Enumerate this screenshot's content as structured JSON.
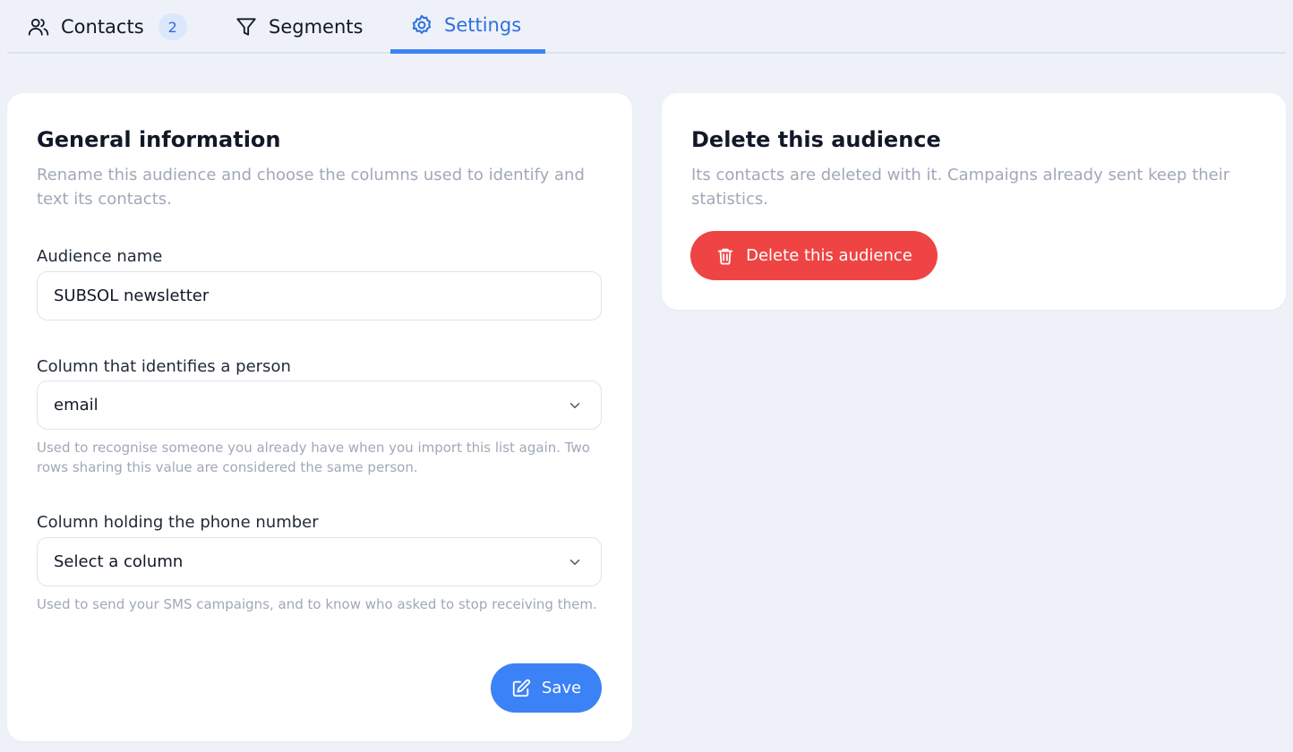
{
  "tabs": {
    "contacts": {
      "label": "Contacts",
      "badge": "2",
      "icon": "users-icon"
    },
    "segments": {
      "label": "Segments",
      "icon": "filter-icon"
    },
    "settings": {
      "label": "Settings",
      "icon": "gear-icon",
      "active": true
    }
  },
  "general": {
    "title": "General information",
    "description": "Rename this audience and choose the columns used to identify and text its contacts.",
    "audience_name": {
      "label": "Audience name",
      "value": "SUBSOL newsletter"
    },
    "id_column": {
      "label": "Column that identifies a person",
      "value": "email",
      "hint": "Used to recognise someone you already have when you import this list again. Two rows sharing this value are considered the same person."
    },
    "phone_column": {
      "label": "Column holding the phone number",
      "value": "Select a column",
      "hint": "Used to send your SMS campaigns, and to know who asked to stop receiving them."
    },
    "save_label": "Save"
  },
  "delete": {
    "title": "Delete this audience",
    "description": "Its contacts are deleted with it. Campaigns already sent keep their statistics.",
    "button_label": "Delete this audience"
  },
  "colors": {
    "accent": "#3b82f6",
    "danger": "#ef4444",
    "background": "#eef2f8"
  }
}
